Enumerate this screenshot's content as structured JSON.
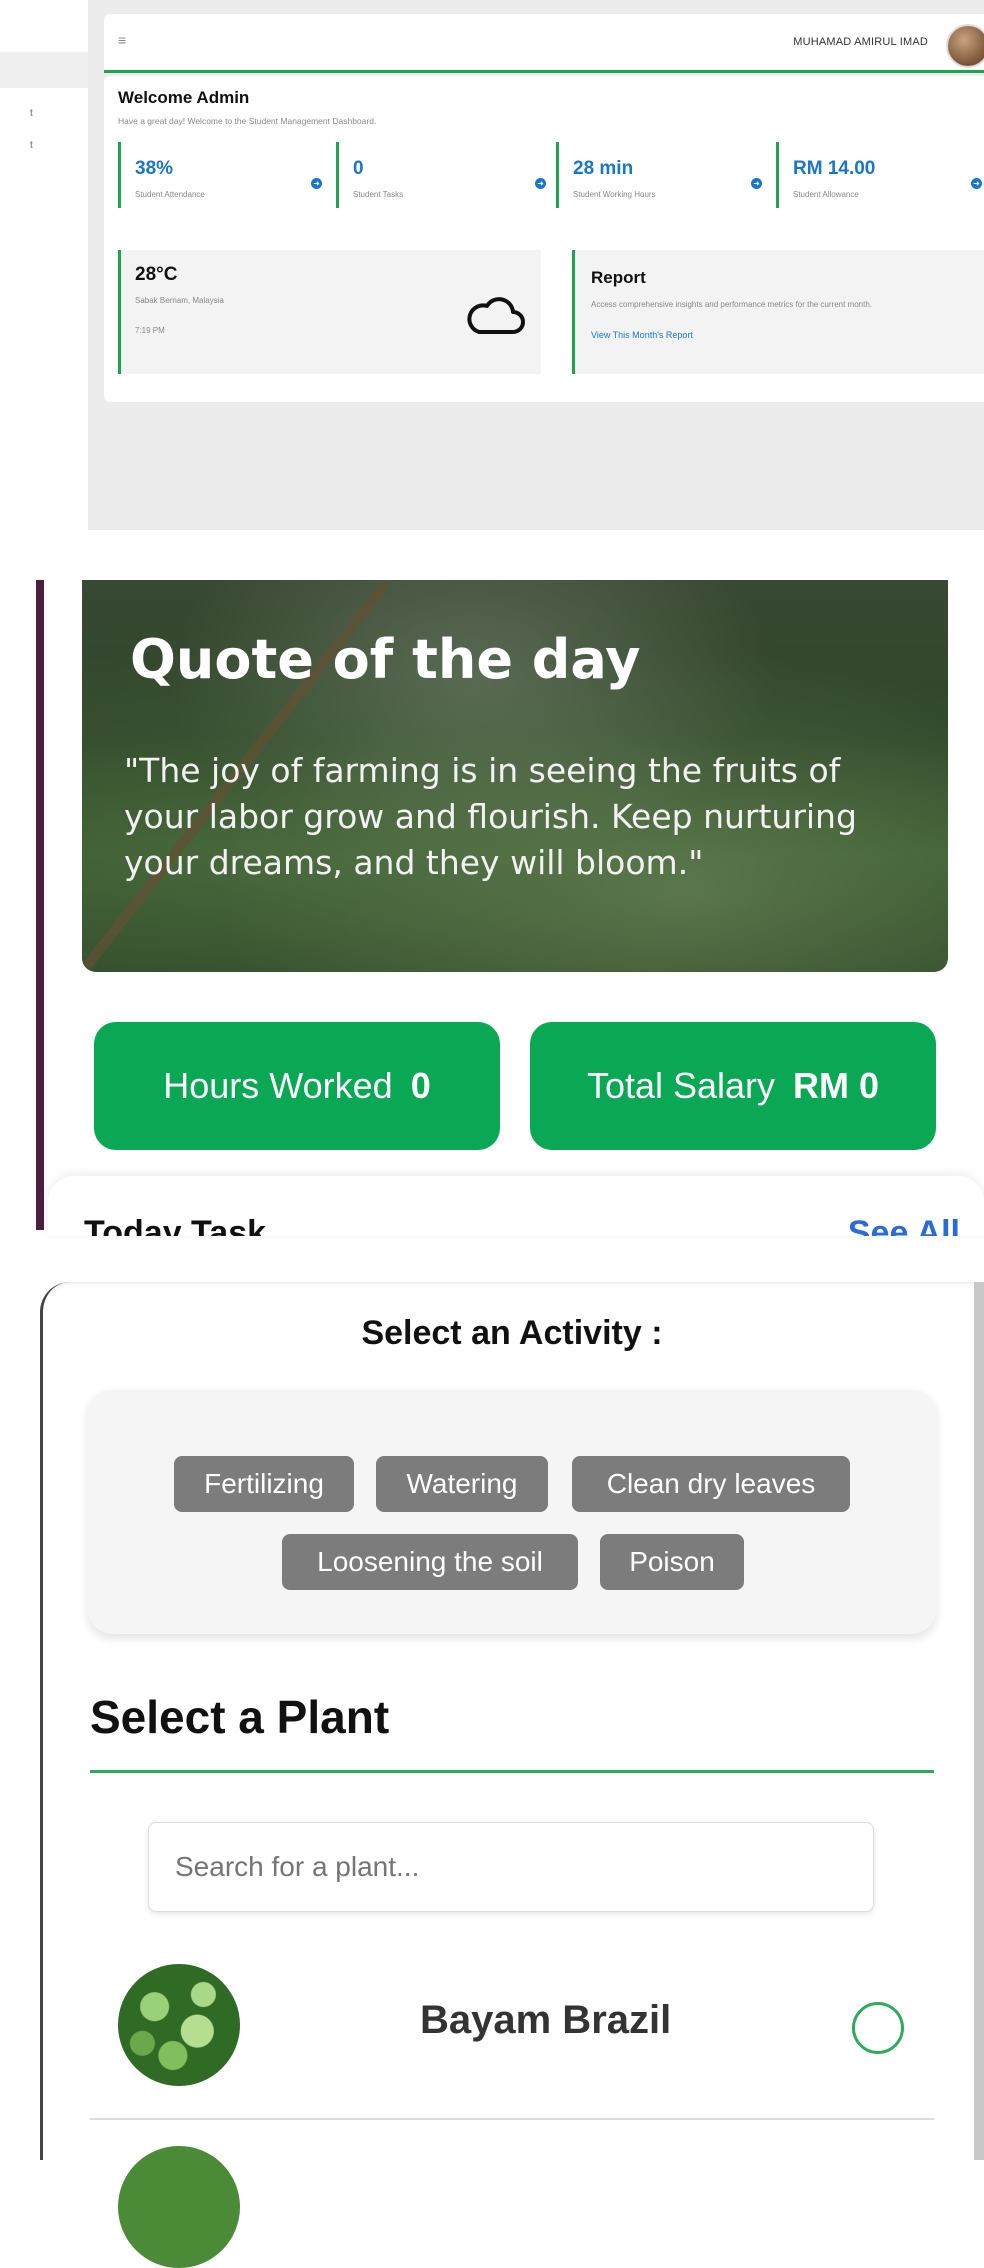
{
  "admin": {
    "menu_icon": "≡",
    "user_name": "MUHAMAD AMIRUL IMAD",
    "sidebar_fragments": [
      "t",
      "t"
    ],
    "welcome_title": "Welcome Admin",
    "welcome_sub": "Have a great day! Welcome to the Student Management Dashboard.",
    "stats": [
      {
        "value": "38%",
        "label": "Student Attendance"
      },
      {
        "value": "0",
        "label": "Student Tasks"
      },
      {
        "value": "28 min",
        "label": "Student Working Hours"
      },
      {
        "value": "RM 14.00",
        "label": "Student Allowance"
      }
    ],
    "weather": {
      "temp": "28°C",
      "location": "Sabak Bernam, Malaysia",
      "time": "7:19 PM"
    },
    "report": {
      "title": "Report",
      "desc": "Access comprehensive insights and performance metrics for the current month.",
      "link": "View This Month's Report"
    }
  },
  "quote": {
    "title": "Quote of the day",
    "text": "\"The joy of farming is in seeing the fruits of your labor grow and flourish. Keep nurturing your dreams, and they will bloom.\"",
    "hours_label": "Hours Worked",
    "hours_value": "0",
    "salary_label": "Total Salary",
    "salary_value": "RM 0",
    "today_task": "Today Task",
    "see_all": "See All"
  },
  "activity": {
    "title": "Select an Activity :",
    "chips": [
      "Fertilizing",
      "Watering",
      "Clean dry leaves",
      "Loosening the soil",
      "Poison"
    ]
  },
  "plant": {
    "title": "Select a Plant",
    "search_placeholder": "Search for a plant...",
    "items": [
      {
        "name": "Bayam Brazil"
      }
    ]
  },
  "colors": {
    "accent_green": "#1fa34f",
    "link_blue": "#1a76c9",
    "pill_green": "#0aa854"
  }
}
